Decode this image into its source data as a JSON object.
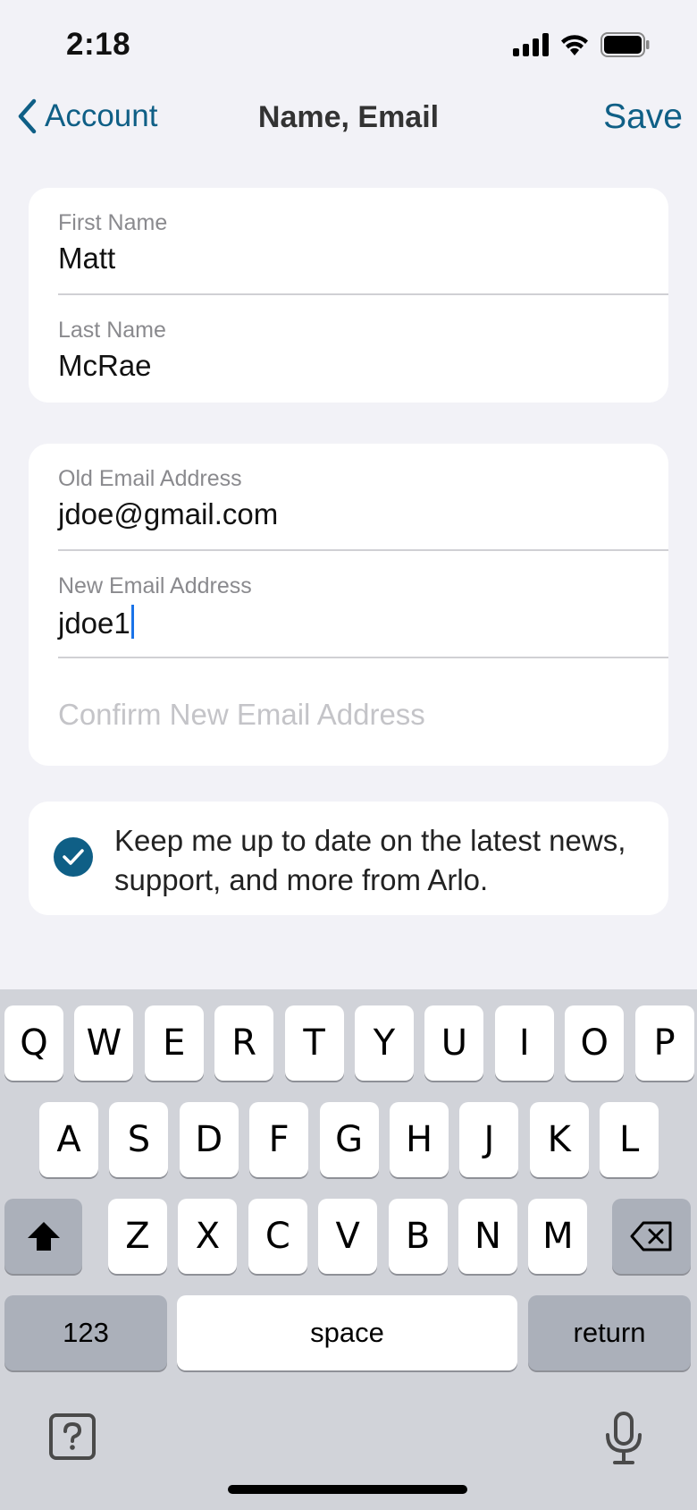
{
  "status": {
    "time": "2:18"
  },
  "nav": {
    "back_label": "Account",
    "title": "Name, Email",
    "save_label": "Save"
  },
  "name_card": {
    "first_name": {
      "label": "First Name",
      "value": "Matt"
    },
    "last_name": {
      "label": "Last Name",
      "value": "McRae"
    }
  },
  "email_card": {
    "old_email": {
      "label": "Old Email Address",
      "value": "jdoe@gmail.com"
    },
    "new_email": {
      "label": "New Email Address",
      "value": "jdoe1"
    },
    "confirm_email": {
      "placeholder": "Confirm New Email Address"
    }
  },
  "optin": {
    "checked": true,
    "text": "Keep me up to date on the latest news, support, and more from Arlo."
  },
  "keyboard": {
    "row1": [
      "Q",
      "W",
      "E",
      "R",
      "T",
      "Y",
      "U",
      "I",
      "O",
      "P"
    ],
    "row2": [
      "A",
      "S",
      "D",
      "F",
      "G",
      "H",
      "J",
      "K",
      "L"
    ],
    "row3": [
      "Z",
      "X",
      "C",
      "V",
      "B",
      "N",
      "M"
    ],
    "numbers_label": "123",
    "space_label": "space",
    "return_label": "return",
    "icons": {
      "shift": "shift-icon",
      "delete": "delete-icon",
      "help": "question-icon",
      "dictation": "microphone-icon"
    }
  },
  "colors": {
    "accent": "#0f5f86",
    "background": "#f2f2f7",
    "keyboard_bg": "#d1d3d9"
  }
}
